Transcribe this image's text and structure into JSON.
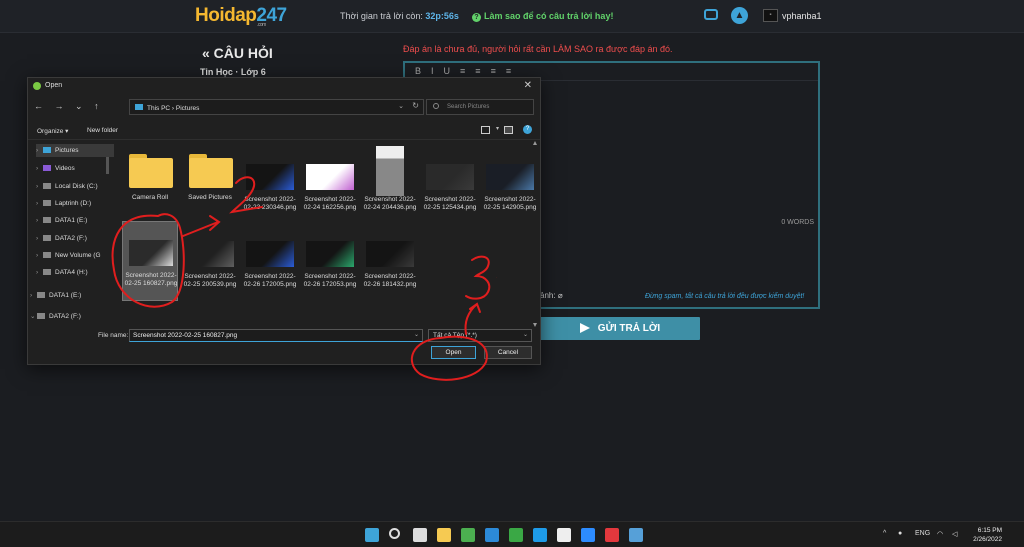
{
  "site": {
    "logo_main": "Hoidap",
    "logo_num": "247",
    "logo_sub": ".com",
    "timer_label": "Thời gian trả lời còn:",
    "timer_value": "32p:56s",
    "tip": "Làm sao để có câu trả lời hay!",
    "username": "vphanba1"
  },
  "page": {
    "question_title": "« CÂU HỎI",
    "question_sub": "Tin Học · Lớp 6",
    "warning": "Đáp án là chưa đủ, người hỏi rất cần LÀM SAO ra được đáp án đó.",
    "toolbar": [
      "B",
      "I",
      "U",
      "≡",
      "≡",
      "≡",
      "≡"
    ],
    "word_count": "0 WORDS",
    "attach_label": "ảnh:",
    "spam_note": "Đừng spam, tất cả câu trả lời đều được kiểm duyệt!",
    "send_label": "GỬI TRẢ LỜI"
  },
  "dialog": {
    "title": "Open",
    "path": [
      "This PC",
      "Pictures"
    ],
    "search_placeholder": "Search Pictures",
    "organize": "Organize ▾",
    "new_folder": "New folder",
    "sidebar": [
      {
        "label": "Pictures",
        "icon": "pictures-icon",
        "color": "#3ea4d8",
        "selected": true,
        "chev": "›"
      },
      {
        "label": "Videos",
        "icon": "videos-icon",
        "color": "#8a5ad6",
        "selected": false,
        "chev": "›"
      },
      {
        "label": "Local Disk (C:)",
        "icon": "drive-icon",
        "color": "#888888",
        "selected": false,
        "chev": "›"
      },
      {
        "label": "Laptrinh (D:)",
        "icon": "drive-icon",
        "color": "#888888",
        "selected": false,
        "chev": "›"
      },
      {
        "label": "DATA1 (E:)",
        "icon": "drive-icon",
        "color": "#888888",
        "selected": false,
        "chev": "›"
      },
      {
        "label": "DATA2 (F:)",
        "icon": "drive-icon",
        "color": "#888888",
        "selected": false,
        "chev": "›"
      },
      {
        "label": "New Volume (G",
        "icon": "drive-icon",
        "color": "#888888",
        "selected": false,
        "chev": "›"
      },
      {
        "label": "DATA4 (H:)",
        "icon": "drive-icon",
        "color": "#888888",
        "selected": false,
        "chev": "›"
      },
      {
        "label": "DATA1 (E:)",
        "icon": "drive-icon",
        "color": "#888888",
        "selected": false,
        "chev": "›"
      },
      {
        "label": "DATA2 (F:)",
        "icon": "drive-icon",
        "color": "#888888",
        "selected": false,
        "chev": "⌄"
      }
    ],
    "files": [
      {
        "name": "Camera Roll",
        "kind": "folder"
      },
      {
        "name": "Saved Pictures",
        "kind": "folder"
      },
      {
        "name": "Screenshot 2022-02-23 230346.png",
        "kind": "shot",
        "c1": "#141414",
        "c2": "#2a5cd8"
      },
      {
        "name": "Screenshot 2022-02-24 162256.png",
        "kind": "shot",
        "c1": "#ffffff",
        "c2": "#c060d0"
      },
      {
        "name": "Screenshot 2022-02-24 204436.png",
        "kind": "calc",
        "c1": "#ffffff",
        "c2": "#888888"
      },
      {
        "name": "Screenshot 2022-02-25 125434.png",
        "kind": "shot",
        "c1": "#2a2a2a",
        "c2": "#3a3a3a"
      },
      {
        "name": "Screenshot 2022-02-25 142905.png",
        "kind": "shot",
        "c1": "#1a1e26",
        "c2": "#4a78a8"
      },
      {
        "name": "Screenshot 2022-02-25 160827.png",
        "kind": "shot",
        "c1": "#2b2b2b",
        "c2": "#dddddd",
        "selected": true
      },
      {
        "name": "Screenshot 2022-02-25 200539.png",
        "kind": "shot",
        "c1": "#202020",
        "c2": "#606060"
      },
      {
        "name": "Screenshot 2022-02-26 172005.png",
        "kind": "shot",
        "c1": "#141414",
        "c2": "#2a5cd8"
      },
      {
        "name": "Screenshot 2022-02-26 172053.png",
        "kind": "shot",
        "c1": "#141414",
        "c2": "#2aa86c"
      },
      {
        "name": "Screenshot 2022-02-26 181432.png",
        "kind": "shot",
        "c1": "#141414",
        "c2": "#3a3a3a"
      }
    ],
    "file_name_label": "File name:",
    "file_name_value": "Screenshot 2022-02-25 160827.png",
    "filter_value": "Tất cả Tệp (*.*)",
    "open_label": "Open",
    "cancel_label": "Cancel"
  },
  "annotations": [
    "2",
    "3"
  ],
  "taskbar": {
    "apps": [
      {
        "icon": "windows-start-icon",
        "color": "#3ea4d8"
      },
      {
        "icon": "search-icon",
        "color": "#dddddd"
      },
      {
        "icon": "task-view-icon",
        "color": "#dddddd"
      },
      {
        "icon": "file-explorer-icon",
        "color": "#f6ca52"
      },
      {
        "icon": "chrome-icon",
        "color": "#4caf50"
      },
      {
        "icon": "vscode-icon",
        "color": "#2c8ad8"
      },
      {
        "icon": "camtasia-icon",
        "color": "#3aa845"
      },
      {
        "icon": "skype-icon",
        "color": "#1e9be8"
      },
      {
        "icon": "maps-icon",
        "color": "#eeeeee"
      },
      {
        "icon": "zoom-icon",
        "color": "#2d8cff"
      },
      {
        "icon": "onenote-icon",
        "color": "#e3383d"
      },
      {
        "icon": "photo-icon",
        "color": "#56a0d8"
      }
    ],
    "lang": "ENG",
    "time": "6:15 PM",
    "date": "2/26/2022"
  }
}
